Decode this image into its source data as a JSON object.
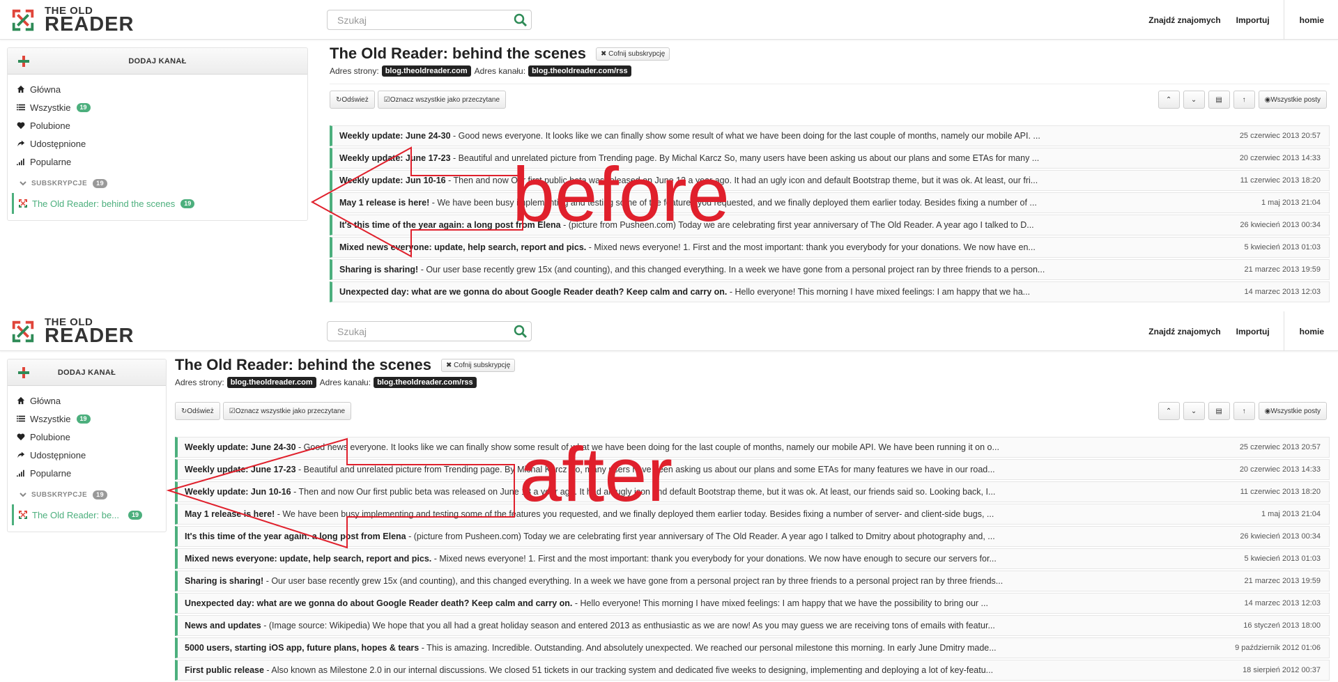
{
  "annotations": {
    "before": "before",
    "after": "after",
    "color": "#e0202c"
  },
  "header": {
    "logo_small": "THE OLD",
    "logo_big": "READER",
    "search_placeholder": "Szukaj",
    "links": [
      "Znajdź znajomych",
      "Importuj",
      "homie"
    ]
  },
  "sidebar": {
    "add_label": "DODAJ KANAŁ",
    "items": [
      {
        "label": "Główna",
        "icon": "home-icon"
      },
      {
        "label": "Wszystkie",
        "icon": "list-icon",
        "badge": "19"
      },
      {
        "label": "Polubione",
        "icon": "heart-icon"
      },
      {
        "label": "Udostępnione",
        "icon": "share-icon"
      },
      {
        "label": "Popularne",
        "icon": "signal-icon"
      }
    ],
    "subs_label": "SUBSKRYPCJE",
    "subs_badge": "19",
    "subscription_before": "The Old Reader: behind the scenes",
    "subscription_after": "The Old Reader: be...",
    "subscription_badge": "19"
  },
  "feed": {
    "title": "The Old Reader: behind the scenes",
    "unsubscribe": "Cofnij subskrypcję",
    "site_label": "Adres strony:",
    "site_url": "blog.theoldreader.com",
    "feed_label": "Adres kanału:",
    "feed_url": "blog.theoldreader.com/rss",
    "refresh": "Odśwież",
    "mark_all": "Oznacz wszystkie jako przeczytane",
    "all_posts": "Wszystkie posty"
  },
  "posts_before": [
    {
      "title": "Weekly update: June 24-30",
      "snippet": " - Good news everyone. It looks like we can finally show some result of what we have been doing for the last couple of months, namely our mobile API. ...",
      "date": "25 czerwiec 2013 20:57"
    },
    {
      "title": "Weekly update: June 17-23",
      "snippet": " - Beautiful and unrelated picture from Trending page. By Michal Karcz So, many users have been asking us about our plans and some ETAs for many ...",
      "date": "20 czerwiec 2013 14:33"
    },
    {
      "title": "Weekly update: Jun 10-16",
      "snippet": " - Then and now Our first public beta was released on June 13 a year ago. It had an ugly icon and default Bootstrap theme, but it was ok. At least, our fri...",
      "date": "11 czerwiec 2013 18:20"
    },
    {
      "title": "May 1 release is here!",
      "snippet": " - We have been busy implementing and testing some of the features you requested, and we finally deployed them earlier today. Besides fixing a number of ...",
      "date": "1 maj 2013 21:04"
    },
    {
      "title": "It's this time of the year again: a long post from Elena",
      "snippet": " - (picture from Pusheen.com) Today we are celebrating first year anniversary of The Old Reader. A year ago I talked to D...",
      "date": "26 kwiecień 2013 00:34"
    },
    {
      "title": "Mixed news everyone: update, help search, report and pics.",
      "snippet": " - Mixed news everyone! 1. First and the most important: thank you everybody for your donations. We now have en...",
      "date": "5 kwiecień 2013 01:03"
    },
    {
      "title": "Sharing is sharing!",
      "snippet": " - Our user base recently grew 15x (and counting), and this changed everything. In a week we have gone from a personal project ran by three friends to a person...",
      "date": "21 marzec 2013 19:59"
    },
    {
      "title": "Unexpected day: what are we gonna do about Google Reader death? Keep calm and carry on.",
      "snippet": " - Hello everyone! This morning I have mixed feelings: I am happy that we ha...",
      "date": "14 marzec 2013 12:03"
    }
  ],
  "posts_after": [
    {
      "title": "Weekly update: June 24-30",
      "snippet": " - Good news everyone. It looks like we can finally show some result of what we have been doing for the last couple of months, namely our mobile API. We have been running it on o...",
      "date": "25 czerwiec 2013 20:57"
    },
    {
      "title": "Weekly update: June 17-23",
      "snippet": " - Beautiful and unrelated picture from Trending page. By Michal Karcz So, many users have been asking us about our plans and some ETAs for many features we have in our road...",
      "date": "20 czerwiec 2013 14:33"
    },
    {
      "title": "Weekly update: Jun 10-16",
      "snippet": " - Then and now Our first public beta was released on June 13 a year ago. It had an ugly icon and default Bootstrap theme, but it was ok. At least, our friends said so. Looking back, I...",
      "date": "11 czerwiec 2013 18:20"
    },
    {
      "title": "May 1 release is here!",
      "snippet": " - We have been busy implementing and testing some of the features you requested, and we finally deployed them earlier today. Besides fixing a number of server- and client-side bugs, ...",
      "date": "1 maj 2013 21:04"
    },
    {
      "title": "It's this time of the year again: a long post from Elena",
      "snippet": " - (picture from Pusheen.com) Today we are celebrating first year anniversary of The Old Reader. A year ago I talked to Dmitry about photography and, ...",
      "date": "26 kwiecień 2013 00:34"
    },
    {
      "title": "Mixed news everyone: update, help search, report and pics.",
      "snippet": " - Mixed news everyone! 1. First and the most important: thank you everybody for your donations. We now have enough to secure our servers for...",
      "date": "5 kwiecień 2013 01:03"
    },
    {
      "title": "Sharing is sharing!",
      "snippet": " - Our user base recently grew 15x (and counting), and this changed everything. In a week we have gone from a personal project ran by three friends to a personal project ran by three friends...",
      "date": "21 marzec 2013 19:59"
    },
    {
      "title": "Unexpected day: what are we gonna do about Google Reader death? Keep calm and carry on.",
      "snippet": " - Hello everyone! This morning I have mixed feelings: I am happy that we have the possibility to bring our ...",
      "date": "14 marzec 2013 12:03"
    },
    {
      "title": "News and updates",
      "snippet": " - (Image source: Wikipedia) We hope that you all had a great holiday season and entered 2013 as enthusiastic as we are now! As you may guess we are receiving tons of emails with featur...",
      "date": "16 styczeń 2013 18:00"
    },
    {
      "title": "5000 users, starting iOS app, future plans, hopes & tears",
      "snippet": " - This is amazing. Incredible. Outstanding. And absolutely unexpected. We reached our personal milestone this morning. In early June Dmitry made...",
      "date": "9 październik 2012 01:06"
    },
    {
      "title": "First public release",
      "snippet": " - Also known as Milestone 2.0 in our internal discussions. We closed 51 tickets in our tracking system and dedicated five weeks to designing, implementing and deploying a lot of key-featu...",
      "date": "18 sierpień 2012 00:37"
    }
  ]
}
